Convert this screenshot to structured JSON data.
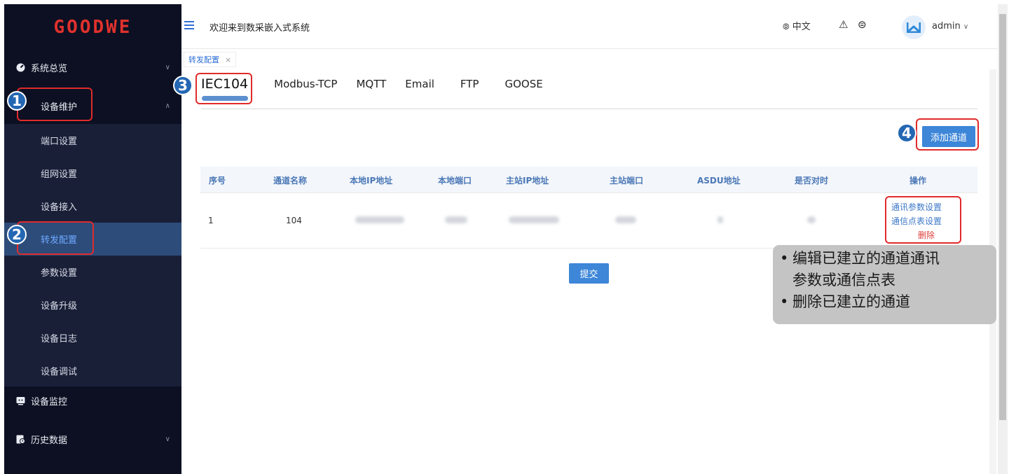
{
  "brand": {
    "logo_text": "GOODWE",
    "accent": "#e0312d"
  },
  "sidebar": {
    "groups": [
      {
        "label": "系统总览",
        "icon": "dashboard-icon"
      },
      {
        "label": "设备维护",
        "icon": "wrench-icon"
      },
      {
        "label": "设备监控",
        "icon": "monitor-icon"
      },
      {
        "label": "历史数据",
        "icon": "history-icon"
      }
    ],
    "sub_items": [
      {
        "label": "端口设置"
      },
      {
        "label": "组网设置"
      },
      {
        "label": "设备接入"
      },
      {
        "label": "转发配置",
        "active": true
      },
      {
        "label": "参数设置"
      },
      {
        "label": "设备升级"
      },
      {
        "label": "设备日志"
      },
      {
        "label": "设备调试"
      }
    ]
  },
  "header": {
    "welcome": "欢迎来到数采嵌入式系统",
    "language": "中文",
    "user": "admin"
  },
  "page_tab": {
    "label": "转发配置",
    "close": "×"
  },
  "protocol_tabs": [
    {
      "label": "IEC104",
      "active": true
    },
    {
      "label": "Modbus-TCP"
    },
    {
      "label": "MQTT"
    },
    {
      "label": "Email"
    },
    {
      "label": "FTP"
    },
    {
      "label": "GOOSE"
    }
  ],
  "toolbar": {
    "add_channel": "添加通道"
  },
  "table": {
    "columns": [
      "序号",
      "通道名称",
      "本地IP地址",
      "本地端口",
      "主站IP地址",
      "主站端口",
      "ASDU地址",
      "是否对时",
      "操作"
    ],
    "rows": [
      {
        "index": "1",
        "name": "104"
      }
    ],
    "actions": [
      "通讯参数设置",
      "通信点表设置",
      "删除"
    ]
  },
  "submit_label": "提交",
  "annotations": {
    "badges": [
      "1",
      "2",
      "3",
      "4"
    ],
    "callout": {
      "bullet": "•",
      "line1": "编辑已建立的通道通讯",
      "line2": "参数或通信点表",
      "line3": "删除已建立的通道"
    }
  }
}
